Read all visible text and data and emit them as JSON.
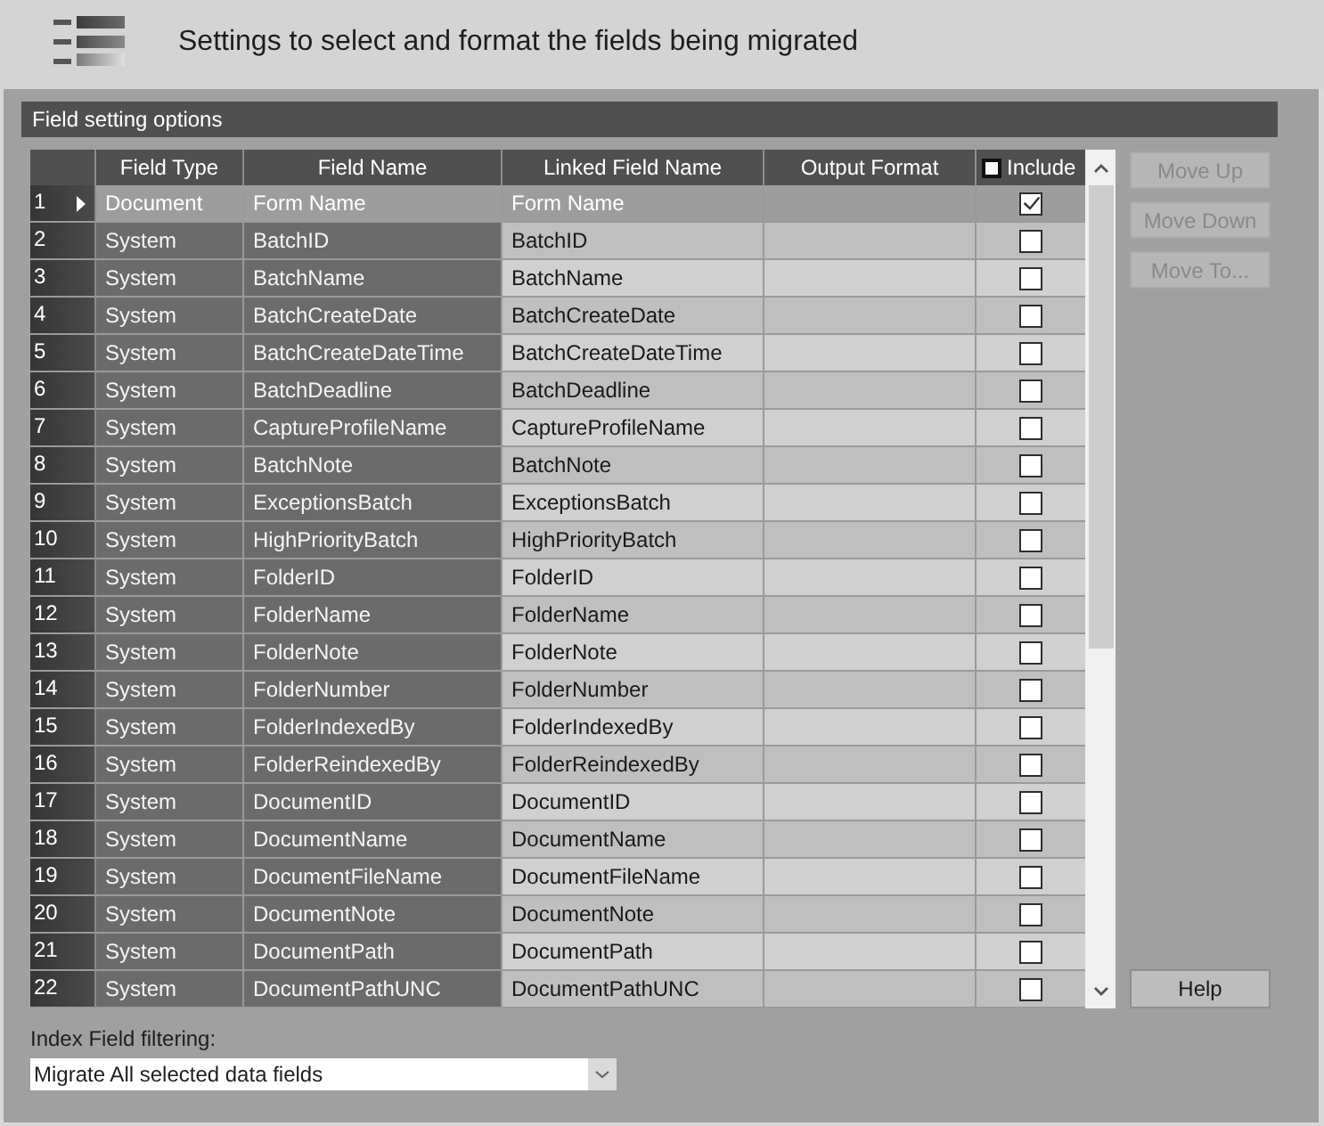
{
  "header": {
    "title": "Settings to select and format the fields being migrated"
  },
  "section": {
    "title": "Field setting options"
  },
  "table": {
    "columns": [
      {
        "label": "Field Type",
        "kind": "text"
      },
      {
        "label": "Field Name",
        "kind": "text"
      },
      {
        "label": "Linked Field Name",
        "kind": "text"
      },
      {
        "label": "Output Format",
        "kind": "text"
      },
      {
        "label": "Include",
        "kind": "checkbox",
        "checked": false
      }
    ],
    "rows": [
      {
        "number": "1",
        "field_type": "Document",
        "field_name": "Form Name",
        "linked_field_name": "Form Name",
        "include": true,
        "selected": true
      },
      {
        "number": "2",
        "field_type": "System",
        "field_name": "BatchID",
        "linked_field_name": "BatchID",
        "include": false,
        "selected": false
      },
      {
        "number": "3",
        "field_type": "System",
        "field_name": "BatchName",
        "linked_field_name": "BatchName",
        "include": false,
        "selected": false
      },
      {
        "number": "4",
        "field_type": "System",
        "field_name": "BatchCreateDate",
        "linked_field_name": "BatchCreateDate",
        "include": false,
        "selected": false
      },
      {
        "number": "5",
        "field_type": "System",
        "field_name": "BatchCreateDateTime",
        "linked_field_name": "BatchCreateDateTime",
        "include": false,
        "selected": false
      },
      {
        "number": "6",
        "field_type": "System",
        "field_name": "BatchDeadline",
        "linked_field_name": "BatchDeadline",
        "include": false,
        "selected": false
      },
      {
        "number": "7",
        "field_type": "System",
        "field_name": "CaptureProfileName",
        "linked_field_name": "CaptureProfileName",
        "include": false,
        "selected": false
      },
      {
        "number": "8",
        "field_type": "System",
        "field_name": "BatchNote",
        "linked_field_name": "BatchNote",
        "include": false,
        "selected": false
      },
      {
        "number": "9",
        "field_type": "System",
        "field_name": "ExceptionsBatch",
        "linked_field_name": "ExceptionsBatch",
        "include": false,
        "selected": false
      },
      {
        "number": "10",
        "field_type": "System",
        "field_name": "HighPriorityBatch",
        "linked_field_name": "HighPriorityBatch",
        "include": false,
        "selected": false
      },
      {
        "number": "11",
        "field_type": "System",
        "field_name": "FolderID",
        "linked_field_name": "FolderID",
        "include": false,
        "selected": false
      },
      {
        "number": "12",
        "field_type": "System",
        "field_name": "FolderName",
        "linked_field_name": "FolderName",
        "include": false,
        "selected": false
      },
      {
        "number": "13",
        "field_type": "System",
        "field_name": "FolderNote",
        "linked_field_name": "FolderNote",
        "include": false,
        "selected": false
      },
      {
        "number": "14",
        "field_type": "System",
        "field_name": "FolderNumber",
        "linked_field_name": "FolderNumber",
        "include": false,
        "selected": false
      },
      {
        "number": "15",
        "field_type": "System",
        "field_name": "FolderIndexedBy",
        "linked_field_name": "FolderIndexedBy",
        "include": false,
        "selected": false
      },
      {
        "number": "16",
        "field_type": "System",
        "field_name": "FolderReindexedBy",
        "linked_field_name": "FolderReindexedBy",
        "include": false,
        "selected": false
      },
      {
        "number": "17",
        "field_type": "System",
        "field_name": "DocumentID",
        "linked_field_name": "DocumentID",
        "include": false,
        "selected": false
      },
      {
        "number": "18",
        "field_type": "System",
        "field_name": "DocumentName",
        "linked_field_name": "DocumentName",
        "include": false,
        "selected": false
      },
      {
        "number": "19",
        "field_type": "System",
        "field_name": "DocumentFileName",
        "linked_field_name": "DocumentFileName",
        "include": false,
        "selected": false
      },
      {
        "number": "20",
        "field_type": "System",
        "field_name": "DocumentNote",
        "linked_field_name": "DocumentNote",
        "include": false,
        "selected": false
      },
      {
        "number": "21",
        "field_type": "System",
        "field_name": "DocumentPath",
        "linked_field_name": "DocumentPath",
        "include": false,
        "selected": false
      },
      {
        "number": "22",
        "field_type": "System",
        "field_name": "DocumentPathUNC",
        "linked_field_name": "DocumentPathUNC",
        "include": false,
        "selected": false
      }
    ]
  },
  "buttons": [
    {
      "label": "Move Up",
      "disabled": true
    },
    {
      "label": "Move Down",
      "disabled": true
    },
    {
      "label": "Move To...",
      "disabled": true
    }
  ],
  "help_button": {
    "label": "Help",
    "disabled": false
  },
  "filter": {
    "label": "Index Field filtering:",
    "value": "Migrate All selected data fields"
  }
}
